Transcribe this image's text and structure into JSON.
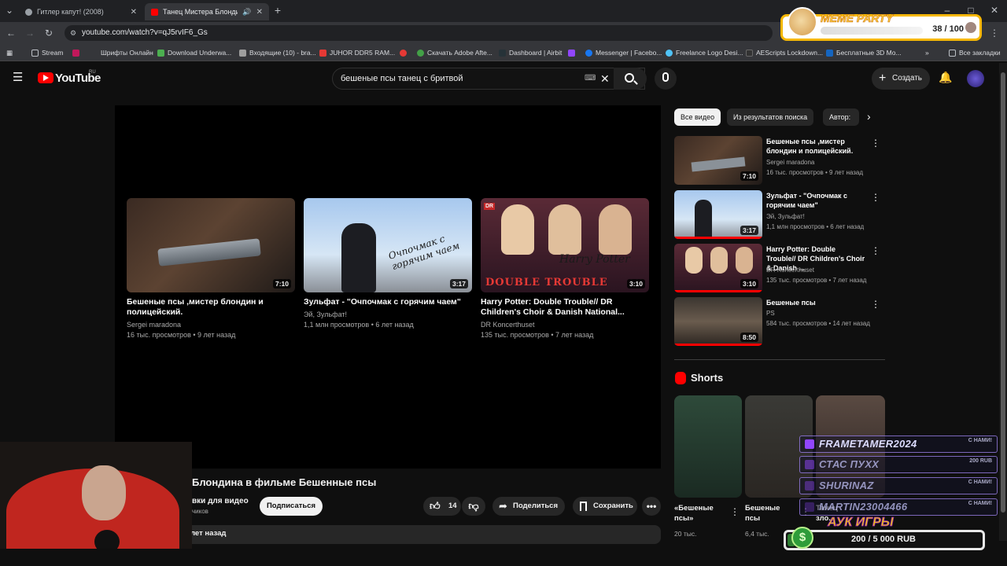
{
  "browser": {
    "tabs": [
      {
        "title": "Гитлер капут! (2008)",
        "active": false
      },
      {
        "title": "Танец Мистера Блондина ",
        "active": true
      }
    ],
    "url": "youtube.com/watch?v=qJ5rvIF6_Gs",
    "bookmarks": [
      "Stream",
      "Шрифты Онлайн",
      "Download Underwa...",
      "Входящие (10) - bra...",
      "JUHOR DDR5 RAM...",
      "Скачать Adobe Afte...",
      "Dashboard | Airbit",
      "Messenger | Facebo...",
      "Freelance Logo Desi...",
      "AEScripts Lockdown...",
      "Бесплатные 3D Mo..."
    ],
    "all_bookmarks": "Все закладки"
  },
  "overlay": {
    "meme_title": "MEME PARTY",
    "meme_count": "38 / 100",
    "chat": [
      {
        "name": "FRAMETAMER2024",
        "action": "С НАМИ!"
      },
      {
        "name": "СТАС ПУХХ",
        "action": "200 RUB"
      },
      {
        "name": "SHURINAZ",
        "action": "С НАМИ!"
      },
      {
        "name": "MARTIN23004466",
        "action": "С НАМИ!"
      }
    ],
    "auction_title": "АУК ИГРЫ",
    "auction_progress": "200 / 5 000 RUB",
    "auction_fraction": 0.04
  },
  "youtube": {
    "logo": "YouTube",
    "region": "RU",
    "search_query": "бешеные псы танец с бритвой",
    "create_label": "Создать",
    "endscreen": [
      {
        "title": "Бешеные псы ,мистер блондин и полицейский.",
        "channel": "Sergei maradona",
        "meta": "16 тыс. просмотров • 9 лет назад",
        "duration": "7:10"
      },
      {
        "title": "Зульфат - \"Очпочмак с горячим чаем\"",
        "channel": "Эй, Зульфат!",
        "meta": "1,1 млн просмотров • 6 лет назад",
        "duration": "3:17"
      },
      {
        "title": "Harry Potter: Double Trouble// DR Children's Choir & Danish National...",
        "channel": "DR Koncerthuset",
        "meta": "135 тыс. просмотров • 7 лет назад",
        "duration": "3:10"
      }
    ],
    "video_title": "Блондина в фильме Бешенные псы",
    "channel_name": "вки для видео",
    "subscribers": "чиков",
    "subscribe_label": "Подписаться",
    "likes": "14",
    "share_label": "Поделиться",
    "save_label": "Сохранить",
    "description_age": "лет назад",
    "chips": [
      "Все видео",
      "Из результатов поиска",
      "Автор: "
    ],
    "related": [
      {
        "title": "Бешеные псы ,мистер блондин и полицейский.",
        "channel": "Sergei maradona",
        "meta": "16 тыс. просмотров • 9 лет назад",
        "duration": "7:10"
      },
      {
        "title": "Зульфат - \"Очпочмак с горячим чаем\"",
        "channel": "Эй, Зульфат!",
        "meta": "1,1 млн просмотров • 6 лет назад",
        "duration": "3:17"
      },
      {
        "title": "Harry Potter: Double Trouble// DR Children's Choir & Danish ...",
        "channel": "DR Koncerthuset",
        "meta": "135 тыс. просмотров • 7 лет назад",
        "duration": "3:10"
      },
      {
        "title": "Бешеные псы",
        "channel": "PS",
        "meta": "584 тыс. просмотров • 14 лет назад",
        "duration": "8:50"
      }
    ],
    "shorts_heading": "Shorts",
    "shorts": [
      {
        "title": "«Бешеные псы»",
        "views": "20 тыс."
      },
      {
        "title": "Бешеные псы",
        "views": "6,4 тыс."
      },
      {
        "title": "Танец зло..."
      }
    ],
    "thumb_texts": {
      "ochpochmak": "Очпочмак с горячим чаем",
      "hp1": "Harry Potter",
      "hp2": "DOUBLE TROUBLE",
      "dr": "DR"
    }
  }
}
